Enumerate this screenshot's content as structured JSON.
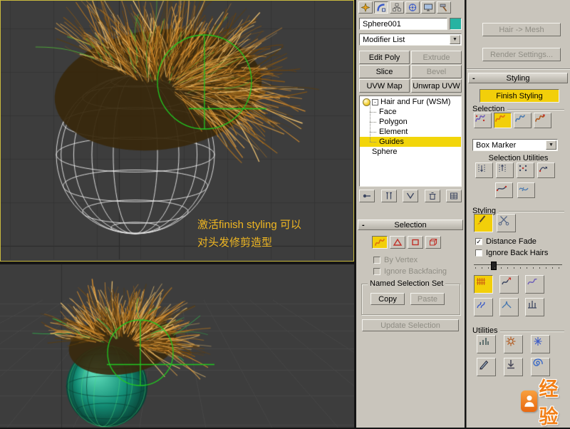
{
  "ui": {
    "collapse_glyph": "-",
    "dropdown_glyph": "▼",
    "check_glyph": "✓"
  },
  "colors": {
    "accent_yellow": "#f2cf0a",
    "object_color": "#27b3a2",
    "annotation_text": "#efb622",
    "guide_highlight": "#f2d50a",
    "watermark_orange": "#f28018"
  },
  "viewport": {
    "annotation_line1": "激活finish styling 可以",
    "annotation_line2": "对头发修剪造型"
  },
  "command_panel": {
    "tabs": [
      {
        "name": "Create"
      },
      {
        "name": "Modify"
      },
      {
        "name": "Hierarchy"
      },
      {
        "name": "Motion"
      },
      {
        "name": "Display"
      },
      {
        "name": "Utilities"
      }
    ],
    "object_name": "Sphere001",
    "modifier_list_label": "Modifier List",
    "modifier_buttons": [
      {
        "label": "Edit Poly",
        "enabled": true
      },
      {
        "label": "Extrude",
        "enabled": false
      },
      {
        "label": "Slice",
        "enabled": true
      },
      {
        "label": "Bevel",
        "enabled": false
      },
      {
        "label": "UVW Map",
        "enabled": true
      },
      {
        "label": "Unwrap UVW",
        "enabled": true
      }
    ],
    "stack_items": [
      "Hair and Fur (WSM)",
      "Face",
      "Polygon",
      "Element",
      "Guides",
      "Sphere"
    ],
    "selected_stack_item": "Guides",
    "selection_rollout": {
      "title": "Selection",
      "by_vertex_label": "By Vertex",
      "ignore_backfacing_label": "Ignore Backfacing",
      "named_selection_set_label": "Named Selection Set",
      "copy_label": "Copy",
      "paste_label": "Paste",
      "update_selection_label": "Update Selection"
    }
  },
  "hair_panel": {
    "hair_to_mesh_label": "Hair -> Mesh",
    "render_settings_label": "Render Settings...",
    "styling_rollout_title": "Styling",
    "finish_styling_label": "Finish Styling",
    "selection_label": "Selection",
    "box_marker_value": "Box Marker",
    "selection_utilities_label": "Selection Utilities",
    "styling_group_label": "Styling",
    "distance_fade_label": "Distance Fade",
    "distance_fade_checked": true,
    "ignore_back_hairs_label": "Ignore Back Hairs",
    "ignore_back_hairs_checked": false,
    "utilities_label": "Utilities"
  },
  "watermark": {
    "text": "经验"
  }
}
